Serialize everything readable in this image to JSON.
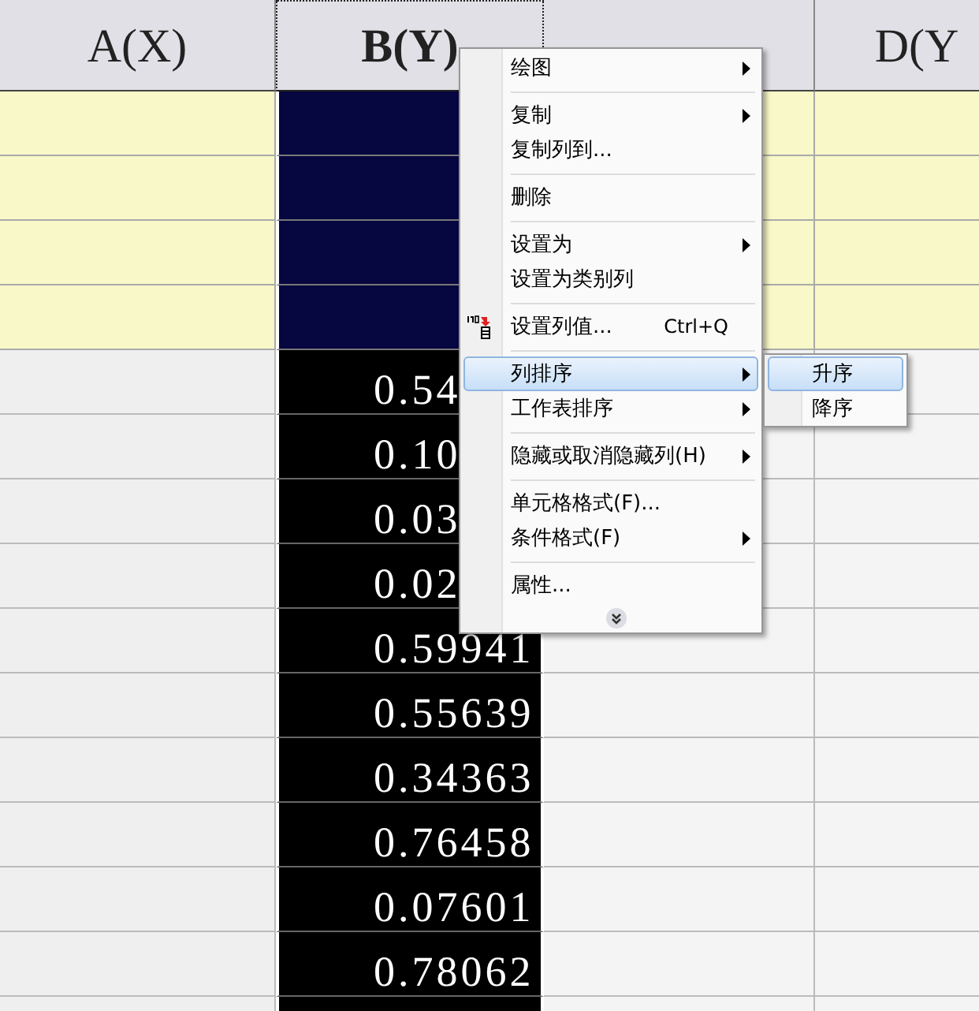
{
  "columns": [
    {
      "label": "A(X)",
      "selected": false
    },
    {
      "label": "B(Y)",
      "selected": true
    },
    {
      "selected": false
    },
    {
      "label": "D(Y",
      "selected": false
    }
  ],
  "column_b_values": [
    "0.54",
    "0.10",
    "0.03",
    "0.02",
    "0.59941",
    "0.55639",
    "0.34363",
    "0.76458",
    "0.07601",
    "0.78062"
  ],
  "context_menu": {
    "items": [
      {
        "kind": "item",
        "label": "绘图",
        "submenu": true,
        "selected": false
      },
      {
        "kind": "separator"
      },
      {
        "kind": "item",
        "label": "复制",
        "submenu": true,
        "selected": false
      },
      {
        "kind": "item",
        "label": "复制列到...",
        "selected": false
      },
      {
        "kind": "separator"
      },
      {
        "kind": "item",
        "label": "删除",
        "selected": false
      },
      {
        "kind": "separator"
      },
      {
        "kind": "item",
        "label": "设置为",
        "submenu": true,
        "selected": false
      },
      {
        "kind": "item",
        "label": "设置为类别列",
        "selected": false
      },
      {
        "kind": "separator"
      },
      {
        "kind": "item",
        "label": "设置列值...",
        "shortcut": "Ctrl+Q",
        "icon": true,
        "selected": false
      },
      {
        "kind": "separator"
      },
      {
        "kind": "item",
        "label": "列排序",
        "submenu": true,
        "selected": true
      },
      {
        "kind": "item",
        "label": "工作表排序",
        "submenu": true,
        "selected": false
      },
      {
        "kind": "separator"
      },
      {
        "kind": "item",
        "label": "隐藏或取消隐藏列(H)",
        "submenu": true,
        "selected": false
      },
      {
        "kind": "separator"
      },
      {
        "kind": "item",
        "label": "单元格格式(F)...",
        "selected": false
      },
      {
        "kind": "item",
        "label": "条件格式(F)",
        "submenu": true,
        "selected": false
      },
      {
        "kind": "separator"
      },
      {
        "kind": "item",
        "label": "属性...",
        "selected": false
      },
      {
        "kind": "expand"
      }
    ]
  },
  "submenu": {
    "items": [
      {
        "label": "升序",
        "selected": true
      },
      {
        "label": "降序",
        "selected": false
      }
    ]
  }
}
